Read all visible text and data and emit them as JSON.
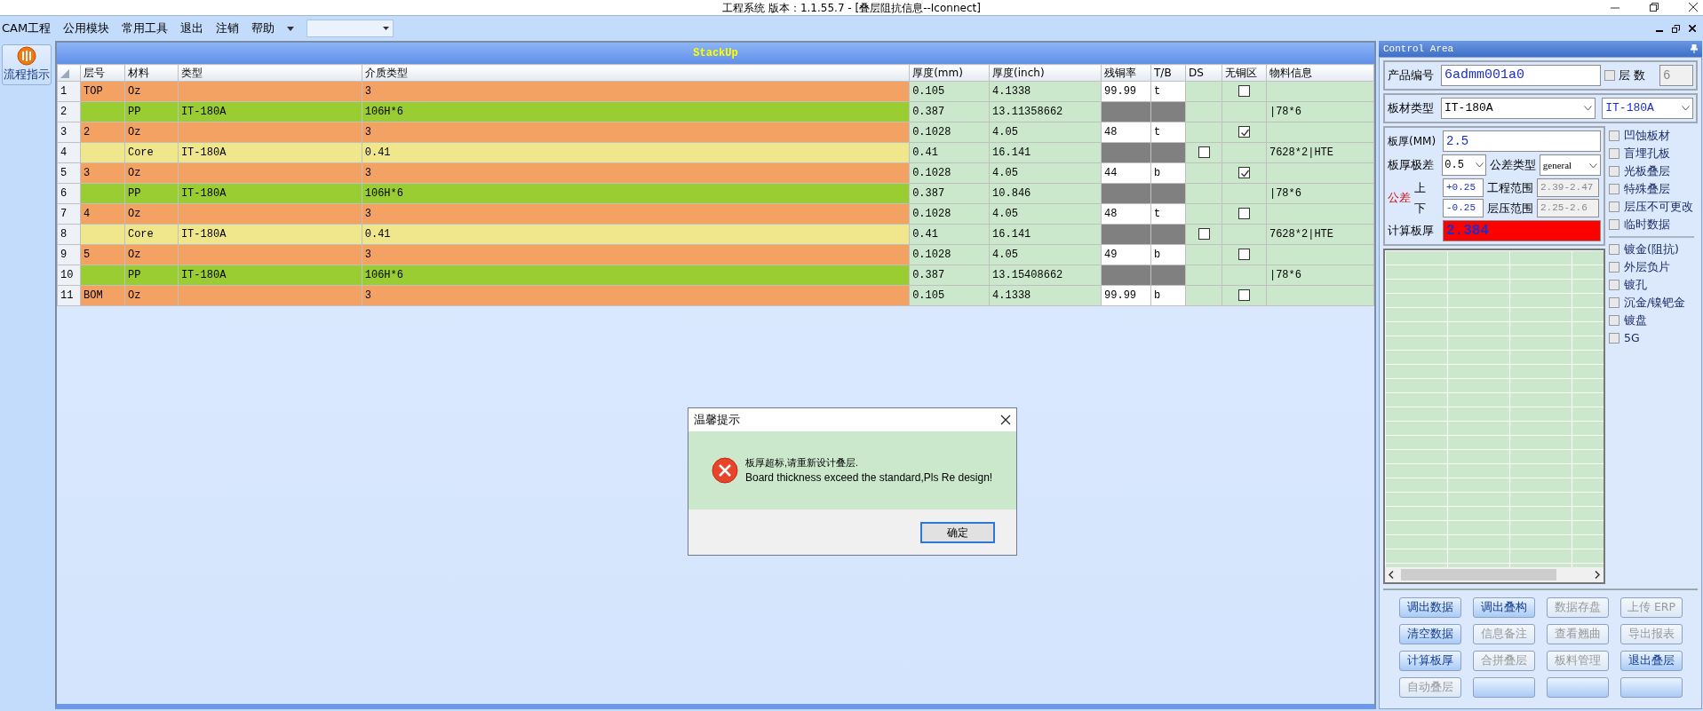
{
  "window": {
    "title": "工程系统   版本：1.1.55.7 - [叠层阻抗信息--Iconnect]"
  },
  "menu": [
    {
      "label": "CAM工程"
    },
    {
      "label": "公用模块"
    },
    {
      "label": "常用工具"
    },
    {
      "label": "退出"
    },
    {
      "label": "注销"
    },
    {
      "label": "帮助"
    }
  ],
  "sidebar": {
    "button": "流程指示"
  },
  "stackup": {
    "title": "StackUp",
    "columns": [
      "层号",
      "材料",
      "类型",
      "介质类型",
      "厚度(mm)",
      "厚度(inch)",
      "残铜率",
      "T/B",
      "DS",
      "无铜区",
      "物料信息"
    ],
    "rows": [
      {
        "index": "1",
        "kind": "copper",
        "layer": "TOP",
        "material": "Oz",
        "dielectric": "3",
        "thickness_mm": "0.105",
        "thickness_inch": "4.1338",
        "residual_copper": "99.99",
        "tb": "t",
        "no_copper_checked": false
      },
      {
        "index": "2",
        "kind": "pp",
        "material": "PP",
        "type": "IT-180A",
        "dielectric": "106H*6",
        "thickness_mm": "0.387",
        "thickness_inch": "13.11358662",
        "material_info": "|78*6"
      },
      {
        "index": "3",
        "kind": "copper",
        "layer": "2",
        "material": "Oz",
        "dielectric": "3",
        "thickness_mm": "0.1028",
        "thickness_inch": "4.05",
        "residual_copper": "48",
        "tb": "t",
        "no_copper_checked": true
      },
      {
        "index": "4",
        "kind": "core",
        "material": "Core",
        "type": "IT-180A",
        "dielectric": "0.41",
        "thickness_mm": "0.41",
        "thickness_inch": "16.141",
        "ds_checked": false,
        "material_info": "7628*2|HTE"
      },
      {
        "index": "5",
        "kind": "copper",
        "layer": "3",
        "material": "Oz",
        "dielectric": "3",
        "thickness_mm": "0.1028",
        "thickness_inch": "4.05",
        "residual_copper": "44",
        "tb": "b",
        "no_copper_checked": true
      },
      {
        "index": "6",
        "kind": "pp",
        "material": "PP",
        "type": "IT-180A",
        "dielectric": "106H*6",
        "thickness_mm": "0.387",
        "thickness_inch": "10.846",
        "material_info": "|78*6"
      },
      {
        "index": "7",
        "kind": "copper",
        "layer": "4",
        "material": "Oz",
        "dielectric": "3",
        "thickness_mm": "0.1028",
        "thickness_inch": "4.05",
        "residual_copper": "48",
        "tb": "t",
        "no_copper_checked": false
      },
      {
        "index": "8",
        "kind": "core",
        "material": "Core",
        "type": "IT-180A",
        "dielectric": "0.41",
        "thickness_mm": "0.41",
        "thickness_inch": "16.141",
        "ds_checked": false,
        "material_info": "7628*2|HTE"
      },
      {
        "index": "9",
        "kind": "copper",
        "layer": "5",
        "material": "Oz",
        "dielectric": "3",
        "thickness_mm": "0.1028",
        "thickness_inch": "4.05",
        "residual_copper": "49",
        "tb": "b",
        "no_copper_checked": false
      },
      {
        "index": "10",
        "kind": "pp",
        "material": "PP",
        "type": "IT-180A",
        "dielectric": "106H*6",
        "thickness_mm": "0.387",
        "thickness_inch": "13.15408662",
        "material_info": "|78*6"
      },
      {
        "index": "11",
        "kind": "copper",
        "layer": "BOM",
        "material": "Oz",
        "dielectric": "3",
        "thickness_mm": "0.105",
        "thickness_inch": "4.1338",
        "residual_copper": "99.99",
        "tb": "b",
        "no_copper_checked": false
      }
    ]
  },
  "control_area": {
    "title": "Control Area",
    "product_label": "产品编号",
    "product_value": "6admm001a0",
    "layer_count_checked": false,
    "layer_count_label": "层 数",
    "layer_count_value": "6",
    "board_type_label": "板材类型",
    "board_type_value": "IT-180A",
    "board_type_value_2": "IT-180A",
    "thickness_label": "板厚(MM)",
    "thickness_value": "2.5",
    "range_label": "板厚极差",
    "range_value": "0.5",
    "tolerance_type_label": "公差类型",
    "tolerance_type_value": "general",
    "tolerance_label": "公差",
    "upper_label": "上",
    "upper_value": "+0.25",
    "eng_range_label": "工程范围",
    "eng_range_value": "2.39-2.47",
    "lower_label": "下",
    "lower_value": "-0.25",
    "press_range_label": "层压范围",
    "press_range_value": "2.25-2.6",
    "calc_label": "计算板厚",
    "calc_value": "2.384",
    "option_groups": [
      [
        {
          "label": "凹蚀板材",
          "checked": false
        },
        {
          "label": "盲埋孔板",
          "checked": false
        },
        {
          "label": "光板叠层",
          "checked": false
        },
        {
          "label": "特殊叠层",
          "checked": false
        },
        {
          "label": "层压不可更改",
          "checked": false
        },
        {
          "label": "临时数据",
          "checked": false
        }
      ],
      [
        {
          "label": "镀金(阻抗)",
          "checked": false
        },
        {
          "label": "外层负片",
          "checked": false
        },
        {
          "label": "镀孔",
          "checked": false
        },
        {
          "label": "沉金/镍钯金",
          "checked": false
        },
        {
          "label": "镀盘",
          "checked": false
        },
        {
          "label": "5G",
          "checked": false
        }
      ]
    ],
    "buttons": [
      {
        "label": "调出数据",
        "disabled": false
      },
      {
        "label": "调出叠构",
        "disabled": false
      },
      {
        "label": "数据存盘",
        "disabled": true
      },
      {
        "label": "上传 ERP",
        "disabled": true
      },
      {
        "label": "清空数据",
        "disabled": false
      },
      {
        "label": "信息备注",
        "disabled": true
      },
      {
        "label": "查看翘曲",
        "disabled": true
      },
      {
        "label": "导出报表",
        "disabled": true
      },
      {
        "label": "计算板厚",
        "disabled": false
      },
      {
        "label": "合拼叠层",
        "disabled": true
      },
      {
        "label": "板料管理",
        "disabled": true
      },
      {
        "label": "退出叠层",
        "disabled": false
      },
      {
        "label": "自动叠层",
        "disabled": true
      },
      {
        "disabled": false
      },
      {
        "disabled": false
      },
      {
        "disabled": false
      }
    ]
  },
  "dialog": {
    "title": "温馨提示",
    "message_cn": "板厚超标,请重新设计叠层.",
    "message_en": "Board thickness exceed the standard,Pls Re design!",
    "button": "确定"
  }
}
